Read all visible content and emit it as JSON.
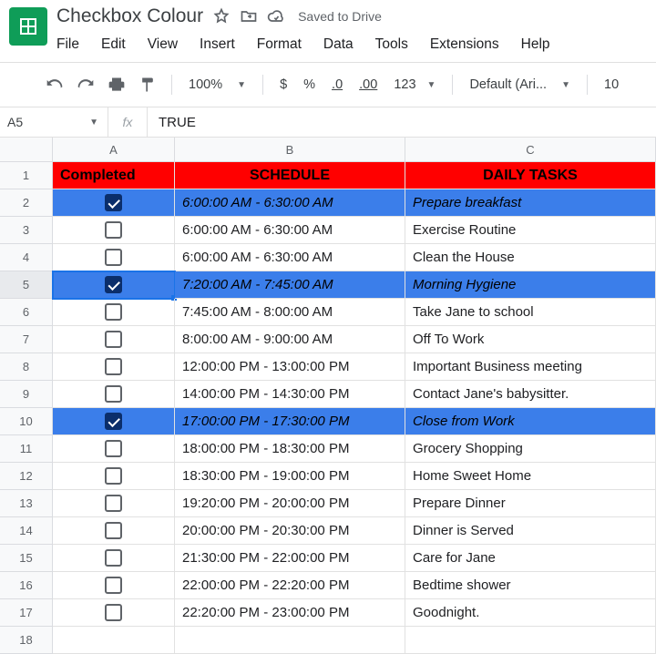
{
  "header": {
    "title": "Checkbox Colour",
    "saved_label": "Saved to Drive"
  },
  "menu": {
    "items": [
      "File",
      "Edit",
      "View",
      "Insert",
      "Format",
      "Data",
      "Tools",
      "Extensions",
      "Help"
    ]
  },
  "toolbar": {
    "zoom": "100%",
    "currency": "$",
    "percent": "%",
    "dec_dec": ".0",
    "dec_inc": ".00",
    "format_num": "123",
    "font": "Default (Ari...",
    "font_size": "10"
  },
  "name_box": "A5",
  "fx_label": "fx",
  "formula": "TRUE",
  "columns": [
    "A",
    "B",
    "C"
  ],
  "header_row": [
    "Completed",
    "SCHEDULE",
    "DAILY TASKS"
  ],
  "rows": [
    {
      "n": 2,
      "checked": true,
      "schedule": "6:00:00 AM - 6:30:00 AM",
      "task": "Prepare breakfast",
      "highlight": true
    },
    {
      "n": 3,
      "checked": false,
      "schedule": "6:00:00 AM - 6:30:00 AM",
      "task": "Exercise Routine",
      "highlight": false
    },
    {
      "n": 4,
      "checked": false,
      "schedule": "6:00:00 AM - 6:30:00 AM",
      "task": "Clean the House",
      "highlight": false
    },
    {
      "n": 5,
      "checked": true,
      "schedule": "7:20:00 AM - 7:45:00 AM",
      "task": "Morning Hygiene",
      "highlight": true,
      "selected": true
    },
    {
      "n": 6,
      "checked": false,
      "schedule": "7:45:00 AM - 8:00:00 AM",
      "task": "Take Jane to school",
      "highlight": false
    },
    {
      "n": 7,
      "checked": false,
      "schedule": "8:00:00 AM - 9:00:00 AM",
      "task": "Off To Work",
      "highlight": false
    },
    {
      "n": 8,
      "checked": false,
      "schedule": "12:00:00 PM - 13:00:00 PM",
      "task": "Important Business meeting",
      "highlight": false
    },
    {
      "n": 9,
      "checked": false,
      "schedule": "14:00:00 PM - 14:30:00 PM",
      "task": "Contact Jane's babysitter.",
      "highlight": false
    },
    {
      "n": 10,
      "checked": true,
      "schedule": "17:00:00 PM - 17:30:00 PM",
      "task": "Close from Work",
      "highlight": true
    },
    {
      "n": 11,
      "checked": false,
      "schedule": "18:00:00 PM - 18:30:00 PM",
      "task": "Grocery Shopping",
      "highlight": false
    },
    {
      "n": 12,
      "checked": false,
      "schedule": "18:30:00 PM - 19:00:00 PM",
      "task": "Home Sweet Home",
      "highlight": false
    },
    {
      "n": 13,
      "checked": false,
      "schedule": "19:20:00 PM - 20:00:00 PM",
      "task": "Prepare Dinner",
      "highlight": false
    },
    {
      "n": 14,
      "checked": false,
      "schedule": "20:00:00 PM - 20:30:00 PM",
      "task": "Dinner is Served",
      "highlight": false
    },
    {
      "n": 15,
      "checked": false,
      "schedule": "21:30:00 PM - 22:00:00 PM",
      "task": "Care for Jane",
      "highlight": false
    },
    {
      "n": 16,
      "checked": false,
      "schedule": "22:00:00 PM - 22:20:00 PM",
      "task": "Bedtime shower",
      "highlight": false
    },
    {
      "n": 17,
      "checked": false,
      "schedule": "22:20:00 PM - 23:00:00 PM",
      "task": "Goodnight.",
      "highlight": false
    },
    {
      "n": 18,
      "checked": null,
      "schedule": "",
      "task": "",
      "highlight": false
    }
  ]
}
